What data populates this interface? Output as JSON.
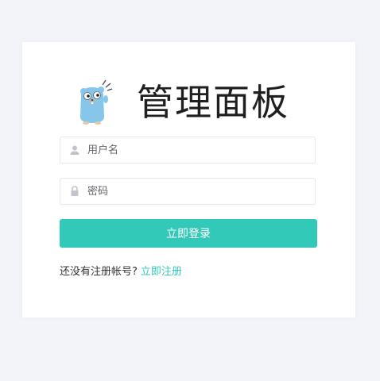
{
  "header": {
    "title": "管理面板",
    "logo_icon": "gopher-mascot-icon"
  },
  "form": {
    "username_placeholder": "用户名",
    "username_value": "",
    "password_placeholder": "密码",
    "password_value": "",
    "login_label": "立即登录"
  },
  "footer": {
    "prompt": "还没有注册帐号?",
    "register_link": "立即注册"
  },
  "colors": {
    "background": "#f3f4f9",
    "card": "#ffffff",
    "accent": "#33c9b9",
    "title": "#1f1f1f",
    "icon": "#c0c4cc"
  }
}
